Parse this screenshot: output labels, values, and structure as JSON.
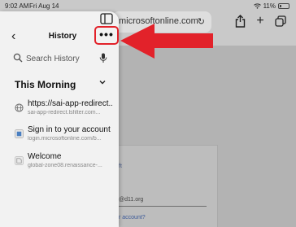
{
  "status_bar": {
    "time": "9:02 AM",
    "date": "Fri Aug 14",
    "battery": "11%"
  },
  "toolbar": {
    "url": "microsoftonline.com",
    "reload_glyph": "↻",
    "share_icon": "share-icon",
    "add_glyph": "+"
  },
  "history_panel": {
    "title": "History",
    "back_glyph": "‹",
    "more_glyph": "•••",
    "search": {
      "placeholder": "Search History"
    },
    "section": {
      "title": "This Morning"
    },
    "items": [
      {
        "title": "https://sai-app-redirect...",
        "url": "sai-app-redirect.lsfilter.com..."
      },
      {
        "title": "Sign in to your account",
        "url": "login.microsoftonline.com/b..."
      },
      {
        "title": "Welcome",
        "url": "global-zone08.renaissance-..."
      }
    ]
  },
  "background_page": {
    "brand": "ft",
    "email": "@d11.org",
    "link": "r account?"
  },
  "annotation": {
    "color": "#e2222a"
  }
}
